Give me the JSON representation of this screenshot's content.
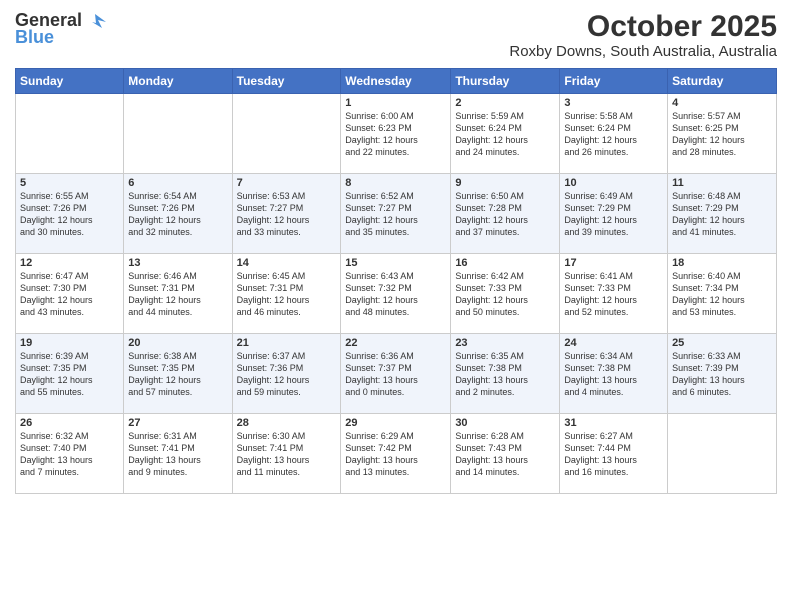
{
  "logo": {
    "line1": "General",
    "line2": "Blue"
  },
  "title": "October 2025",
  "subtitle": "Roxby Downs, South Australia, Australia",
  "days_of_week": [
    "Sunday",
    "Monday",
    "Tuesday",
    "Wednesday",
    "Thursday",
    "Friday",
    "Saturday"
  ],
  "weeks": [
    [
      {
        "day": "",
        "info": ""
      },
      {
        "day": "",
        "info": ""
      },
      {
        "day": "",
        "info": ""
      },
      {
        "day": "1",
        "info": "Sunrise: 6:00 AM\nSunset: 6:23 PM\nDaylight: 12 hours\nand 22 minutes."
      },
      {
        "day": "2",
        "info": "Sunrise: 5:59 AM\nSunset: 6:24 PM\nDaylight: 12 hours\nand 24 minutes."
      },
      {
        "day": "3",
        "info": "Sunrise: 5:58 AM\nSunset: 6:24 PM\nDaylight: 12 hours\nand 26 minutes."
      },
      {
        "day": "4",
        "info": "Sunrise: 5:57 AM\nSunset: 6:25 PM\nDaylight: 12 hours\nand 28 minutes."
      }
    ],
    [
      {
        "day": "5",
        "info": "Sunrise: 6:55 AM\nSunset: 7:26 PM\nDaylight: 12 hours\nand 30 minutes."
      },
      {
        "day": "6",
        "info": "Sunrise: 6:54 AM\nSunset: 7:26 PM\nDaylight: 12 hours\nand 32 minutes."
      },
      {
        "day": "7",
        "info": "Sunrise: 6:53 AM\nSunset: 7:27 PM\nDaylight: 12 hours\nand 33 minutes."
      },
      {
        "day": "8",
        "info": "Sunrise: 6:52 AM\nSunset: 7:27 PM\nDaylight: 12 hours\nand 35 minutes."
      },
      {
        "day": "9",
        "info": "Sunrise: 6:50 AM\nSunset: 7:28 PM\nDaylight: 12 hours\nand 37 minutes."
      },
      {
        "day": "10",
        "info": "Sunrise: 6:49 AM\nSunset: 7:29 PM\nDaylight: 12 hours\nand 39 minutes."
      },
      {
        "day": "11",
        "info": "Sunrise: 6:48 AM\nSunset: 7:29 PM\nDaylight: 12 hours\nand 41 minutes."
      }
    ],
    [
      {
        "day": "12",
        "info": "Sunrise: 6:47 AM\nSunset: 7:30 PM\nDaylight: 12 hours\nand 43 minutes."
      },
      {
        "day": "13",
        "info": "Sunrise: 6:46 AM\nSunset: 7:31 PM\nDaylight: 12 hours\nand 44 minutes."
      },
      {
        "day": "14",
        "info": "Sunrise: 6:45 AM\nSunset: 7:31 PM\nDaylight: 12 hours\nand 46 minutes."
      },
      {
        "day": "15",
        "info": "Sunrise: 6:43 AM\nSunset: 7:32 PM\nDaylight: 12 hours\nand 48 minutes."
      },
      {
        "day": "16",
        "info": "Sunrise: 6:42 AM\nSunset: 7:33 PM\nDaylight: 12 hours\nand 50 minutes."
      },
      {
        "day": "17",
        "info": "Sunrise: 6:41 AM\nSunset: 7:33 PM\nDaylight: 12 hours\nand 52 minutes."
      },
      {
        "day": "18",
        "info": "Sunrise: 6:40 AM\nSunset: 7:34 PM\nDaylight: 12 hours\nand 53 minutes."
      }
    ],
    [
      {
        "day": "19",
        "info": "Sunrise: 6:39 AM\nSunset: 7:35 PM\nDaylight: 12 hours\nand 55 minutes."
      },
      {
        "day": "20",
        "info": "Sunrise: 6:38 AM\nSunset: 7:35 PM\nDaylight: 12 hours\nand 57 minutes."
      },
      {
        "day": "21",
        "info": "Sunrise: 6:37 AM\nSunset: 7:36 PM\nDaylight: 12 hours\nand 59 minutes."
      },
      {
        "day": "22",
        "info": "Sunrise: 6:36 AM\nSunset: 7:37 PM\nDaylight: 13 hours\nand 0 minutes."
      },
      {
        "day": "23",
        "info": "Sunrise: 6:35 AM\nSunset: 7:38 PM\nDaylight: 13 hours\nand 2 minutes."
      },
      {
        "day": "24",
        "info": "Sunrise: 6:34 AM\nSunset: 7:38 PM\nDaylight: 13 hours\nand 4 minutes."
      },
      {
        "day": "25",
        "info": "Sunrise: 6:33 AM\nSunset: 7:39 PM\nDaylight: 13 hours\nand 6 minutes."
      }
    ],
    [
      {
        "day": "26",
        "info": "Sunrise: 6:32 AM\nSunset: 7:40 PM\nDaylight: 13 hours\nand 7 minutes."
      },
      {
        "day": "27",
        "info": "Sunrise: 6:31 AM\nSunset: 7:41 PM\nDaylight: 13 hours\nand 9 minutes."
      },
      {
        "day": "28",
        "info": "Sunrise: 6:30 AM\nSunset: 7:41 PM\nDaylight: 13 hours\nand 11 minutes."
      },
      {
        "day": "29",
        "info": "Sunrise: 6:29 AM\nSunset: 7:42 PM\nDaylight: 13 hours\nand 13 minutes."
      },
      {
        "day": "30",
        "info": "Sunrise: 6:28 AM\nSunset: 7:43 PM\nDaylight: 13 hours\nand 14 minutes."
      },
      {
        "day": "31",
        "info": "Sunrise: 6:27 AM\nSunset: 7:44 PM\nDaylight: 13 hours\nand 16 minutes."
      },
      {
        "day": "",
        "info": ""
      }
    ]
  ]
}
